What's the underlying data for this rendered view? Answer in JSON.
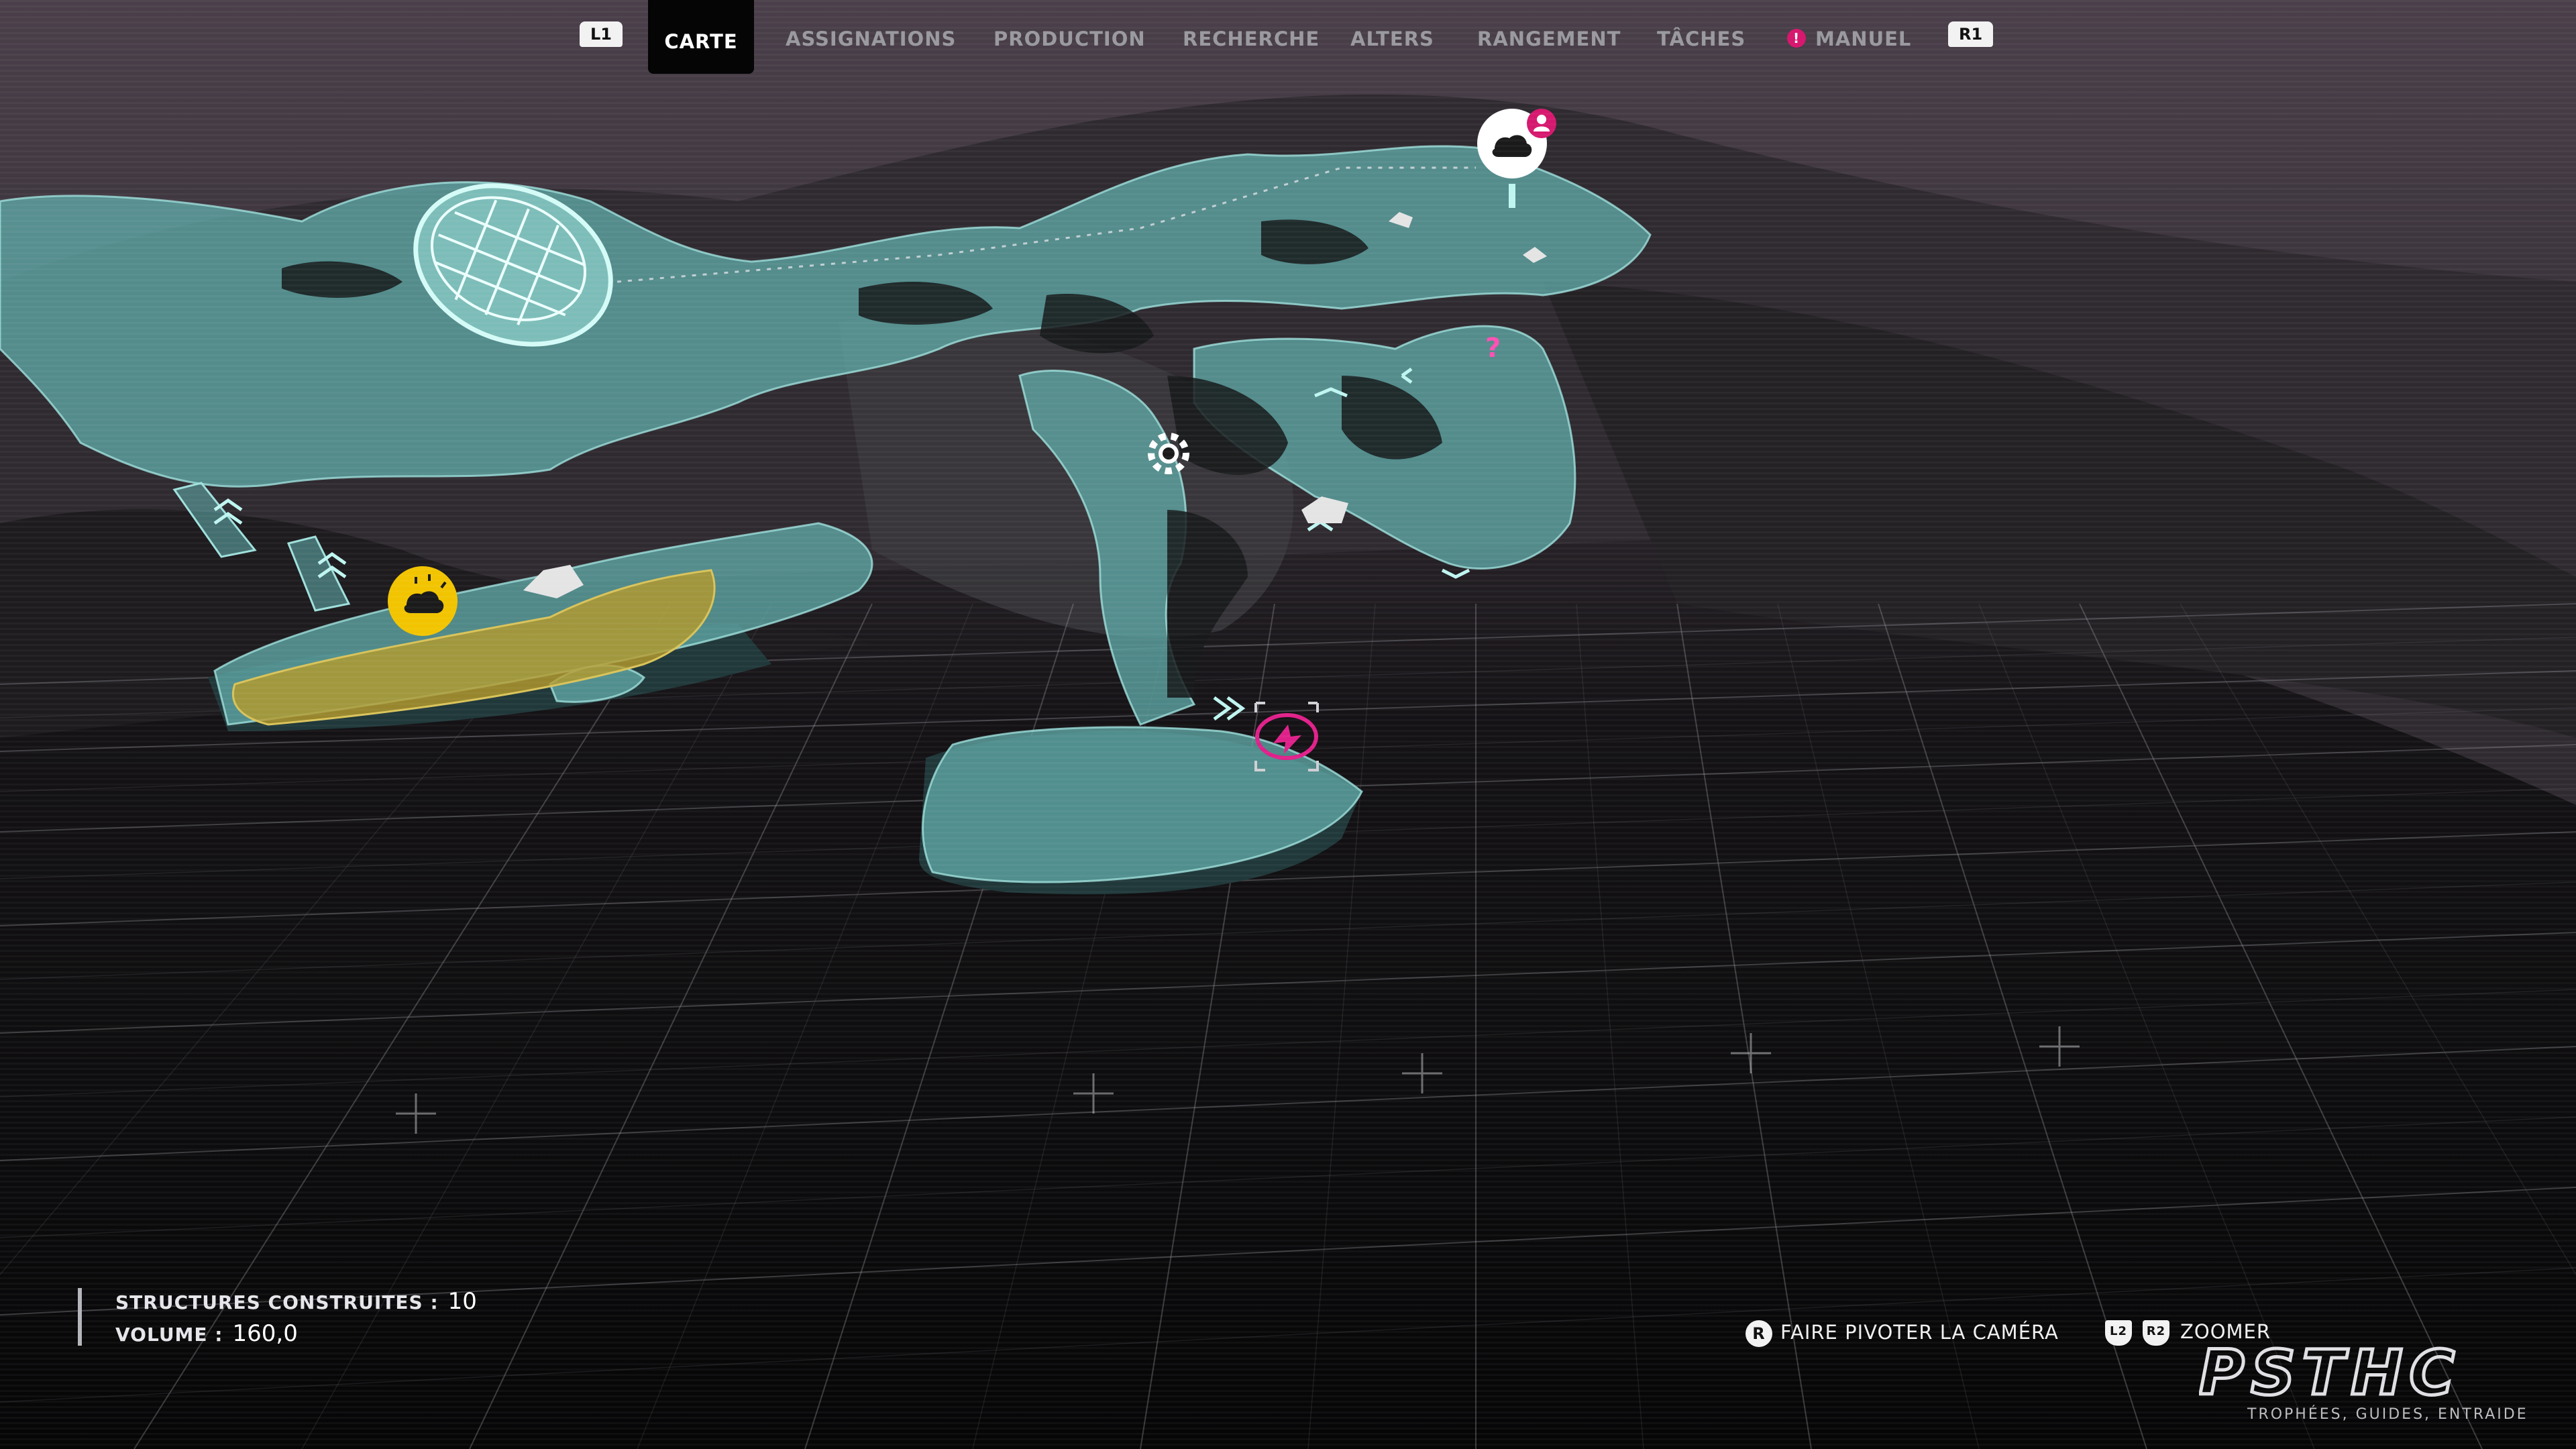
{
  "nav": {
    "left_shoulder": "L1",
    "right_shoulder": "R1",
    "tabs": [
      "CARTE",
      "ASSIGNATIONS",
      "PRODUCTION",
      "RECHERCHE",
      "ALTERS",
      "RANGEMENT",
      "TÂCHES",
      "MANUEL"
    ],
    "active_tab": "CARTE",
    "manual_alert_icon": "exclamation-badge-icon"
  },
  "stats": {
    "structures_label": "STRUCTURES CONSTRUITES :",
    "structures_value": "10",
    "volume_label": "VOLUME :",
    "volume_value": "160,0"
  },
  "controls": {
    "rotate_button": "R",
    "rotate_label": "FAIRE PIVOTER LA CAMÉRA",
    "zoom_button_left": "L2",
    "zoom_button_right": "R2",
    "zoom_label": "ZOOMER"
  },
  "map": {
    "unknown_marker": "?",
    "icons": [
      "hatch-icon",
      "player-location-icon",
      "alter-base-icon",
      "alert-person-icon",
      "relay-gear-icon",
      "objective-target-icon",
      "chevron-icon",
      "rock-icon"
    ]
  },
  "watermark": {
    "logo": "PSTHC",
    "tagline": "TROPHÉES, GUIDES, ENTRAIDE"
  },
  "colors": {
    "accent": "#d6186f",
    "map_teal": "#5fa8a6",
    "base_yellow": "#f2c400",
    "active_tab_bg": "#050506",
    "inactive_tab": "#9a9aa0"
  }
}
